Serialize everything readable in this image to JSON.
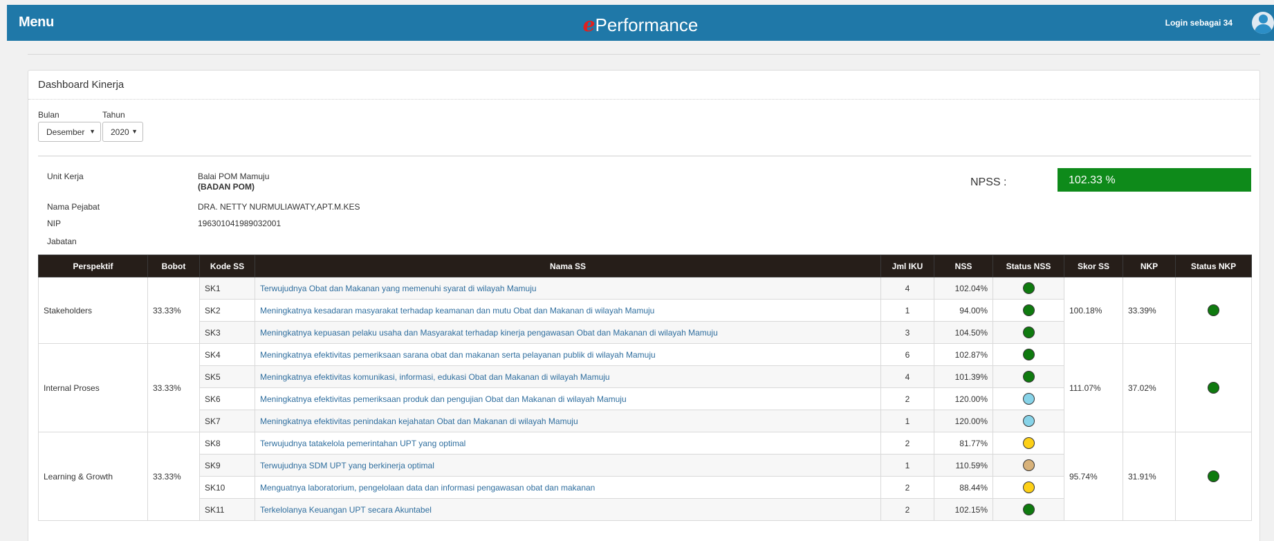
{
  "header": {
    "menu_label": "Menu",
    "brand_prefix": "e",
    "brand_rest": "Performance",
    "login_text": "Login sebagai 34"
  },
  "panel": {
    "title": "Dashboard Kinerja"
  },
  "filters": {
    "bulan_label": "Bulan",
    "bulan_value": "Desember",
    "tahun_label": "Tahun",
    "tahun_value": "2020"
  },
  "info": {
    "unit_kerja_label": "Unit Kerja",
    "unit_kerja_value": "Balai POM Mamuju",
    "unit_kerja_sub": "(BADAN POM)",
    "nama_pejabat_label": "Nama Pejabat",
    "nama_pejabat_value": "DRA. NETTY NURMULIAWATY,APT.M.KES",
    "nip_label": "NIP",
    "nip_value": "196301041989032001",
    "jabatan_label": "Jabatan",
    "npss_label": "NPSS :",
    "npss_value": "102.33 %"
  },
  "colors": {
    "topbar": "#1f78a8",
    "npss_bg": "#0e8a1a",
    "status_green": "#0f7a0f",
    "status_lightblue": "#87d3e8",
    "status_yellow": "#fdd017",
    "status_tan": "#d8b27a"
  },
  "table": {
    "headers": [
      "Perspektif",
      "Bobot",
      "Kode SS",
      "Nama SS",
      "Jml IKU",
      "NSS",
      "Status NSS",
      "Skor SS",
      "NKP",
      "Status NKP"
    ],
    "groups": [
      {
        "perspektif": "Stakeholders",
        "bobot": "33.33%",
        "skor_ss": "100.18%",
        "nkp": "33.39%",
        "status_nkp": "green",
        "rows": [
          {
            "kode": "SK1",
            "nama": "Terwujudnya Obat dan Makanan yang memenuhi syarat di wilayah Mamuju",
            "jml_iku": "4",
            "nss": "102.04%",
            "status": "green"
          },
          {
            "kode": "SK2",
            "nama": "Meningkatnya kesadaran masyarakat terhadap keamanan dan mutu Obat dan Makanan di wilayah Mamuju",
            "jml_iku": "1",
            "nss": "94.00%",
            "status": "green"
          },
          {
            "kode": "SK3",
            "nama": "Meningkatnya kepuasan pelaku usaha dan Masyarakat terhadap kinerja pengawasan Obat dan Makanan di wilayah Mamuju",
            "jml_iku": "3",
            "nss": "104.50%",
            "status": "green"
          }
        ]
      },
      {
        "perspektif": "Internal Proses",
        "bobot": "33.33%",
        "skor_ss": "111.07%",
        "nkp": "37.02%",
        "status_nkp": "green",
        "rows": [
          {
            "kode": "SK4",
            "nama": "Meningkatnya efektivitas pemeriksaan sarana obat dan makanan serta pelayanan publik di wilayah Mamuju",
            "jml_iku": "6",
            "nss": "102.87%",
            "status": "green"
          },
          {
            "kode": "SK5",
            "nama": "Meningkatnya efektivitas komunikasi, informasi, edukasi Obat dan Makanan di wilayah Mamuju",
            "jml_iku": "4",
            "nss": "101.39%",
            "status": "green"
          },
          {
            "kode": "SK6",
            "nama": "Meningkatnya efektivitas pemeriksaan produk dan pengujian Obat dan Makanan di wilayah Mamuju",
            "jml_iku": "2",
            "nss": "120.00%",
            "status": "lightblue"
          },
          {
            "kode": "SK7",
            "nama": "Meningkatnya efektivitas penindakan kejahatan Obat dan Makanan di wilayah Mamuju",
            "jml_iku": "1",
            "nss": "120.00%",
            "status": "lightblue"
          }
        ]
      },
      {
        "perspektif": "Learning & Growth",
        "bobot": "33.33%",
        "skor_ss": "95.74%",
        "nkp": "31.91%",
        "status_nkp": "green",
        "rows": [
          {
            "kode": "SK8",
            "nama": "Terwujudnya tatakelola pemerintahan UPT yang optimal",
            "jml_iku": "2",
            "nss": "81.77%",
            "status": "yellow"
          },
          {
            "kode": "SK9",
            "nama": "Terwujudnya SDM UPT yang berkinerja optimal",
            "jml_iku": "1",
            "nss": "110.59%",
            "status": "tan"
          },
          {
            "kode": "SK10",
            "nama": "Menguatnya laboratorium, pengelolaan data dan informasi pengawasan obat dan makanan",
            "jml_iku": "2",
            "nss": "88.44%",
            "status": "yellow"
          },
          {
            "kode": "SK11",
            "nama": "Terkelolanya Keuangan UPT secara Akuntabel",
            "jml_iku": "2",
            "nss": "102.15%",
            "status": "green"
          }
        ]
      }
    ]
  }
}
